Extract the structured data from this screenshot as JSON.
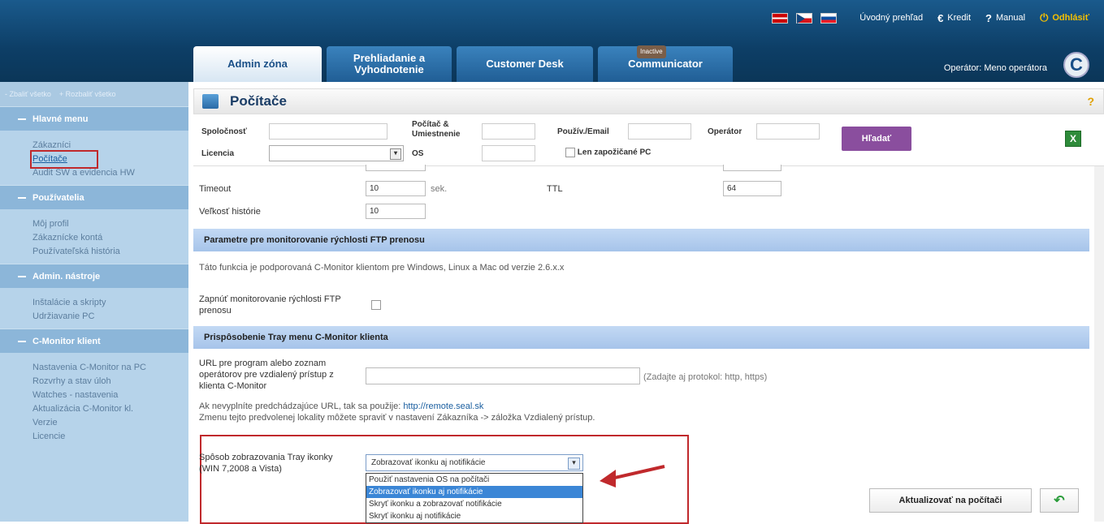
{
  "topbar": {
    "overview": "Úvodný prehľad",
    "credit": "Kredit",
    "manual": "Manual",
    "logout": "Odhlásiť"
  },
  "tabs": [
    {
      "label": "Admin zóna"
    },
    {
      "label": "Prehliadanie a Vyhodnotenie"
    },
    {
      "label": "Customer Desk"
    },
    {
      "label": "Communicator",
      "badge": "Inactive"
    }
  ],
  "operator": "Operátor: Meno operátora",
  "sidebar": {
    "collapse_all": "- Zbaliť všetko",
    "expand_all": "+ Rozbaliť všetko",
    "sections": [
      {
        "title": "Hlavné menu",
        "items": [
          "Zákazníci",
          "Počítače",
          "Audit SW a evidencia HW"
        ]
      },
      {
        "title": "Používatelia",
        "items": [
          "Môj profil",
          "Zákaznícke kontá",
          "Používateľská história"
        ]
      },
      {
        "title": "Admin. nástroje",
        "items": [
          "Inštalácie a skripty",
          "Udržiavanie PC"
        ]
      },
      {
        "title": "C-Monitor klient",
        "items": [
          "Nastavenia C-Monitor na PC",
          "Rozvrhy a stav úloh",
          "Watches - nastavenia",
          "Aktualizácia C-Monitor kl.",
          "Verzie",
          "Licencie"
        ]
      }
    ]
  },
  "page": {
    "title": "Počítače",
    "help": "?"
  },
  "filter": {
    "company_label": "Spoločnosť",
    "computer_label": "Počítač & Umiestnenie",
    "user_label": "Použív./Email",
    "operator_label": "Operátor",
    "license_label": "Licencia",
    "os_label": "OS",
    "borrowed_label": "Len zapožičané PC",
    "search_button": "Hľadať"
  },
  "form": {
    "timeout_label": "Timeout",
    "timeout_value": "10",
    "timeout_unit": "sek.",
    "ttl_label": "TTL",
    "ttl_value": "64",
    "history_label": "Veľkosť histórie",
    "history_value": "10",
    "ftp_section": "Parametre pre monitorovanie rýchlosti FTP prenosu",
    "ftp_info": "Táto funkcia je podporovaná C-Monitor klientom pre Windows, Linux a Mac od verzie 2.6.x.x",
    "ftp_enable_label": "Zapnúť monitorovanie rýchlosti FTP prenosu",
    "tray_section": "Prispôsobenie Tray menu C-Monitor klienta",
    "url_label": "URL pre program alebo zoznam operátorov pre vzdialený prístup z klienta C-Monitor",
    "url_hint": "(Zadajte aj protokol: http, https)",
    "url_note_prefix": "Ak nevyplníte predchádzajúce URL, tak sa použije: ",
    "url_note_link": "http://remote.seal.sk",
    "url_note_2": "Zmenu tejto predvolenej lokality môžete spraviť v nastavení Zákazníka -> záložka Vzdialený prístup.",
    "tray_label": "Spôsob zobrazovania Tray ikonky (WIN 7,2008 a Vista)",
    "tray_selected": "Zobrazovať ikonku aj notifikácie",
    "tray_options": [
      "Použiť nastavenia OS na počítači",
      "Zobrazovať ikonku aj notifikácie",
      "Skryť ikonku a zobrazovať notifikácie",
      "Skryť ikonku aj notifikácie"
    ],
    "update_button": "Aktualizovať na počítači"
  },
  "colors": {
    "header": "#0d3e66",
    "sidebar": "#b6d3ea",
    "band": "#a6c4ea",
    "highlight": "#c0292c",
    "search": "#8a4e9e"
  }
}
